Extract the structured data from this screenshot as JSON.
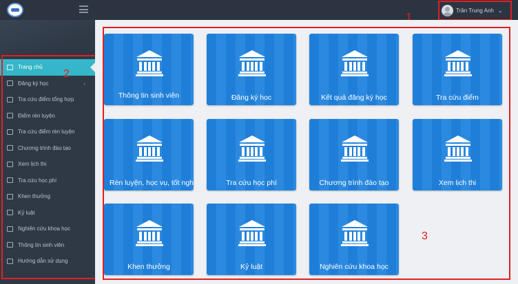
{
  "header": {
    "user_name": "Trần Trung Anh",
    "annotation_1": "1"
  },
  "sidebar": {
    "annotation_2": "2",
    "items": [
      {
        "label": "Trang chủ"
      },
      {
        "label": "Đăng ký học"
      },
      {
        "label": "Tra cứu điểm tổng hợp"
      },
      {
        "label": "Điểm rèn luyện"
      },
      {
        "label": "Tra cứu điểm rèn luyện"
      },
      {
        "label": "Chương trình đào tạo"
      },
      {
        "label": "Xem lịch thi"
      },
      {
        "label": "Tra cứu học phí"
      },
      {
        "label": "Khen thưởng"
      },
      {
        "label": "Kỷ luật"
      },
      {
        "label": "Nghiên cứu khoa học"
      },
      {
        "label": "Thông tin sinh viên"
      },
      {
        "label": "Hướng dẫn sử dụng"
      }
    ]
  },
  "main": {
    "annotation_3": "3",
    "tiles": [
      {
        "label": "Thông tin sinh viên"
      },
      {
        "label": "Đăng ký học"
      },
      {
        "label": "Kết quả đăng ký học"
      },
      {
        "label": "Tra cứu điểm"
      },
      {
        "label": "Rèn luyện, học vụ, tốt nghiệp"
      },
      {
        "label": "Tra cứu học phí"
      },
      {
        "label": "Chương trình đào tạo"
      },
      {
        "label": "Xem lịch thi"
      },
      {
        "label": "Khen thưởng"
      },
      {
        "label": "Kỷ luật"
      },
      {
        "label": "Nghiên cứu khoa học"
      }
    ]
  },
  "colors": {
    "topbar": "#2b3440",
    "sidebar": "#2f3946",
    "active_item": "#35b7c9",
    "tile_blue": "#1f7fd8",
    "annotation_red": "#e02020"
  },
  "icons": {
    "logo": "university-logo",
    "menu_toggle": "hamburger-icon",
    "tile_icon": "bank-building-icon"
  }
}
